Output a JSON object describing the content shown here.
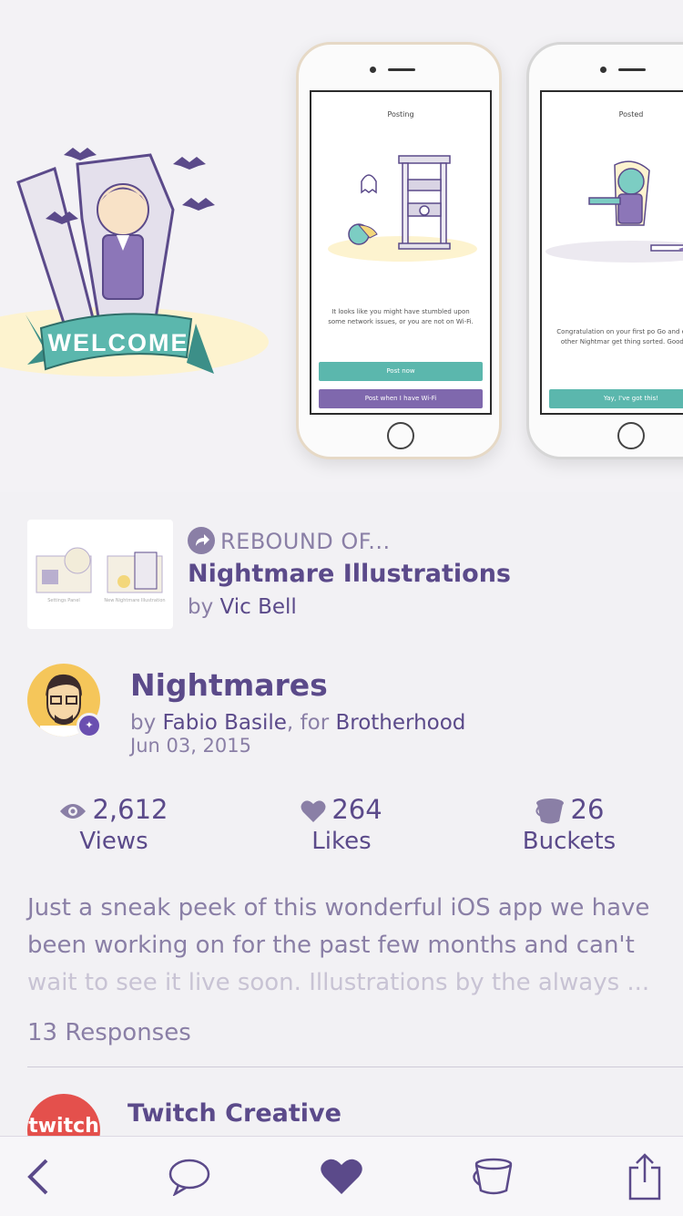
{
  "hero": {
    "welcome_banner": "WELCOME",
    "screen1": {
      "title": "Posting",
      "message": "It looks like you might have stumbled upon some network issues, or you are not on Wi-Fi.",
      "button_primary": "Post now",
      "button_secondary": "Post when I have Wi-Fi"
    },
    "screen2": {
      "title": "Posted",
      "message": "Congratulation on your first po Go and explore other Nightmar get thing sorted. Good luck!",
      "button_primary": "Yay, I've got this!"
    }
  },
  "rebound": {
    "label": "REBOUND OF...",
    "title": "Nightmare Illustrations",
    "by_prefix": "by",
    "author": "Vic Bell",
    "thumb_caption_left": "Settings Panel",
    "thumb_caption_right": "New Nightmare Illustration"
  },
  "shot": {
    "title": "Nightmares",
    "by_prefix": "by",
    "author": "Fabio Basile",
    "for_prefix": ", for",
    "team": "Brotherhood",
    "date": "Jun 03, 2015"
  },
  "stats": {
    "views": {
      "value": "2,612",
      "label": "Views",
      "icon": "eye-icon"
    },
    "likes": {
      "value": "264",
      "label": "Likes",
      "icon": "heart-icon"
    },
    "buckets": {
      "value": "26",
      "label": "Buckets",
      "icon": "bucket-icon"
    }
  },
  "description": {
    "line1": "Just a sneak peek of this wonderful iOS app we have",
    "line2": "been working on for the past few months and can't",
    "line3": "wait to see it live soon. Illustrations by the always ..."
  },
  "responses": {
    "count_label": "13 Responses",
    "first": {
      "name": "Twitch Creative",
      "avatar_text": "twitch"
    }
  },
  "tabbar": {
    "back": "chevron-left-icon",
    "comment": "comment-icon",
    "like": "heart-icon",
    "bucket": "bucket-icon",
    "share": "share-icon"
  },
  "colors": {
    "primary_purple": "#5b4a8a",
    "muted_purple": "#8a7fa6",
    "teal": "#5bb7ad",
    "background": "#f2f1f4"
  }
}
